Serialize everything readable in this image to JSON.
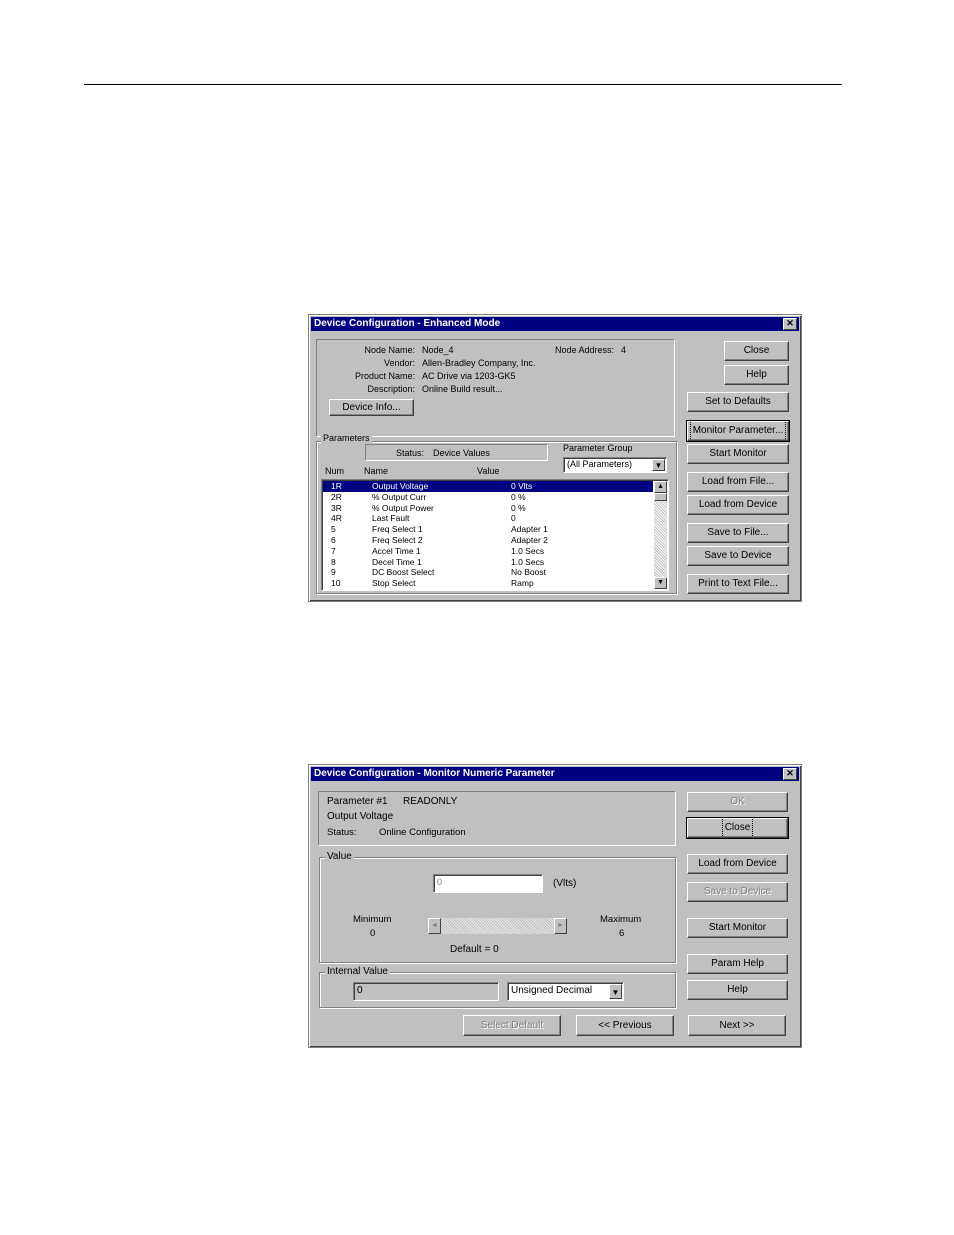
{
  "window1": {
    "title": "Device Configuration - Enhanced Mode",
    "close_glyph": "✕",
    "info": {
      "node_name_label": "Node Name:",
      "node_name": "Node_4",
      "node_address_label": "Node Address:",
      "node_address": "4",
      "vendor_label": "Vendor:",
      "vendor": "Allen-Bradley Company, Inc.",
      "product_label": "Product Name:",
      "product": "AC Drive via 1203-GK5",
      "description_label": "Description:",
      "description": "Online Build result..."
    },
    "device_info_button": "Device Info...",
    "parameters_group": "Parameters",
    "status_label": "Status:",
    "status_value": "Device Values",
    "param_group_label": "Parameter Group",
    "param_group_value": "(All Parameters)",
    "col_num": "Num",
    "col_name": "Name",
    "col_value": "Value",
    "rows": [
      {
        "num": "1R",
        "name": "Output Voltage",
        "value": "0 Vlts"
      },
      {
        "num": "2R",
        "name": "% Output Curr",
        "value": "0 %"
      },
      {
        "num": "3R",
        "name": "% Output Power",
        "value": "0 %"
      },
      {
        "num": "4R",
        "name": "Last Fault",
        "value": "0"
      },
      {
        "num": "5",
        "name": "Freq Select 1",
        "value": "Adapter 1"
      },
      {
        "num": "6",
        "name": "Freq Select 2",
        "value": "Adapter 2"
      },
      {
        "num": "7",
        "name": "Accel Time 1",
        "value": "1.0 Secs"
      },
      {
        "num": "8",
        "name": "Decel Time 1",
        "value": "1.0 Secs"
      },
      {
        "num": "9",
        "name": "DC Boost Select",
        "value": "No Boost"
      },
      {
        "num": "10",
        "name": "Stop Select",
        "value": "Ramp"
      }
    ],
    "buttons": {
      "close": "Close",
      "help": "Help",
      "set_defaults": "Set to Defaults",
      "monitor_parameter": "Monitor Parameter...",
      "start_monitor": "Start Monitor",
      "load_file": "Load from File...",
      "load_device": "Load from Device",
      "save_file": "Save to File...",
      "save_device": "Save to Device",
      "print_text": "Print to Text File..."
    }
  },
  "window2": {
    "title": "Device Configuration - Monitor Numeric Parameter",
    "close_glyph": "✕",
    "param_line": "Parameter #1",
    "readonly": "READONLY",
    "param_name": "Output Voltage",
    "status_label": "Status:",
    "status_value": "Online Configuration",
    "value_group": "Value",
    "value_field": "0",
    "units": "(Vlts)",
    "minimum_label": "Minimum",
    "minimum_value": "0",
    "maximum_label": "Maximum",
    "maximum_value": "6",
    "default_text": "Default = 0",
    "internal_group": "Internal Value",
    "internal_value": "0",
    "format_value": "Unsigned Decimal",
    "buttons": {
      "ok": "OK",
      "close": "Close",
      "load_device": "Load from Device",
      "save_device": "Save to Device",
      "start_monitor": "Start Monitor",
      "param_help": "Param Help",
      "help": "Help",
      "select_default": "Select Default",
      "previous": "<< Previous",
      "next": "Next >>"
    }
  },
  "icons": {
    "scroll_up": "▲",
    "scroll_down": "▼",
    "dropdown": "▼",
    "scroll_left": "◄",
    "scroll_right": "►"
  }
}
